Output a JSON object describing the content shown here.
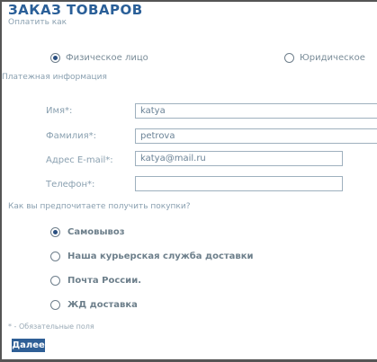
{
  "form": {
    "title": "ЗАКАЗ ТОВАРОВ",
    "payer_section_label": "Оплатить как",
    "payer_options": [
      {
        "label": "Физическое лицо",
        "checked": true
      },
      {
        "label": "Юридическое",
        "checked": false
      }
    ],
    "payment_info_label": "Платежная информация",
    "fields": {
      "name": {
        "label": "Имя*:",
        "value": "katya"
      },
      "surname": {
        "label": "Фамилия*:",
        "value": "petrova"
      },
      "email": {
        "label": "Адрес E-mail*:",
        "value": "katya@mail.ru"
      },
      "phone": {
        "label": "Телефон*:",
        "value": ""
      }
    },
    "delivery_question": "Как вы предпочитаете получить покупки?",
    "delivery_options": [
      {
        "label": "Самовывоз",
        "checked": true
      },
      {
        "label": "Наша курьерская служба доставки",
        "checked": false
      },
      {
        "label": "Почта России.",
        "checked": false
      },
      {
        "label": "ЖД доставка",
        "checked": false
      }
    ],
    "required_note": "* - Обязательные поля",
    "submit_label": "Далее"
  }
}
